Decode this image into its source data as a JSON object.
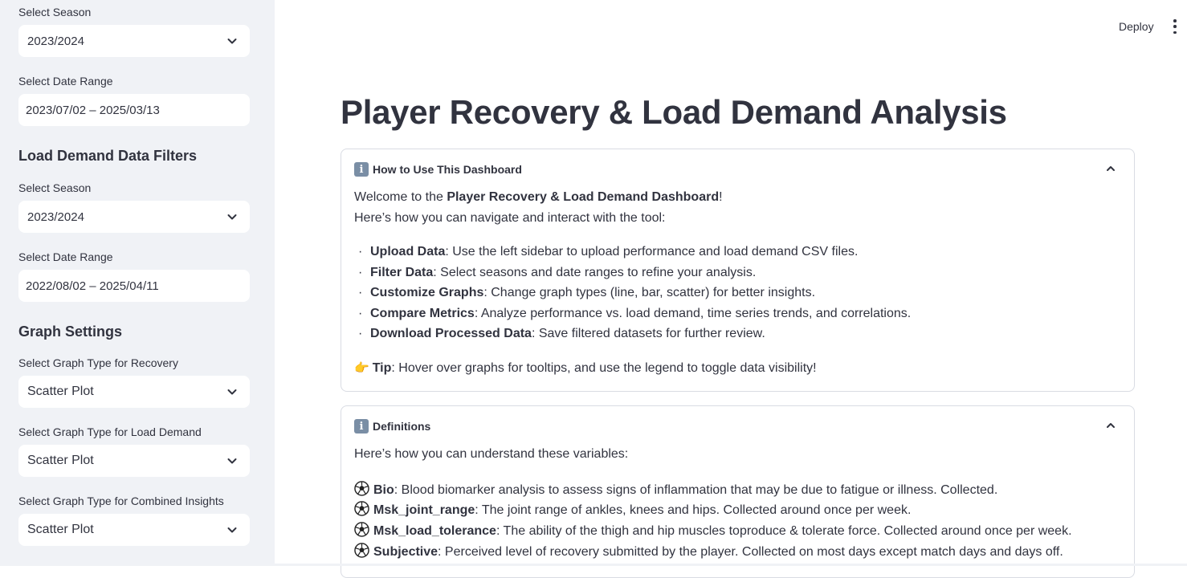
{
  "sidebar": {
    "recovery_season_label": "Select Season",
    "recovery_season_value": "2023/2024",
    "recovery_date_label": "Select Date Range",
    "recovery_date_value": "2023/07/02 – 2025/03/13",
    "load_heading": "Load Demand Data Filters",
    "load_season_label": "Select Season",
    "load_season_value": "2023/2024",
    "load_date_label": "Select Date Range",
    "load_date_value": "2022/08/02 – 2025/04/11",
    "graph_heading": "Graph Settings",
    "graph_recovery_label": "Select Graph Type for Recovery",
    "graph_recovery_value": "Scatter Plot",
    "graph_load_label": "Select Graph Type for Load Demand",
    "graph_load_value": "Scatter Plot",
    "graph_combined_label": "Select Graph Type for Combined Insights",
    "graph_combined_value": "Scatter Plot"
  },
  "header": {
    "deploy_label": "Deploy"
  },
  "main": {
    "title": "Player Recovery & Load Demand Analysis",
    "how_to": {
      "title": "How to Use This Dashboard",
      "welcome_prefix": "Welcome to the ",
      "welcome_bold": "Player Recovery & Load Demand Dashboard",
      "welcome_suffix": "!",
      "intro": "Here’s how you can navigate and interact with the tool:",
      "items": [
        {
          "bold": "Upload Data",
          "text": ": Use the left sidebar to upload performance and load demand CSV files."
        },
        {
          "bold": "Filter Data",
          "text": ": Select seasons and date ranges to refine your analysis."
        },
        {
          "bold": "Customize Graphs",
          "text": ": Change graph types (line, bar, scatter) for better insights."
        },
        {
          "bold": "Compare Metrics",
          "text": ": Analyze performance vs. load demand, time series trends, and correlations."
        },
        {
          "bold": "Download Processed Data",
          "text": ": Save filtered datasets for further review."
        }
      ],
      "tip_bold": "Tip",
      "tip_text": ": Hover over graphs for tooltips, and use the legend to toggle data visibility!"
    },
    "definitions": {
      "title": "Definitions",
      "intro": "Here’s how you can understand these variables:",
      "items": [
        {
          "bold": "Bio",
          "text": ": Blood biomarker analysis to assess signs of inflammation that may be due to fatigue or illness. Collected."
        },
        {
          "bold": "Msk_joint_range",
          "text": ": The joint range of ankles, knees and hips. Collected around once per week."
        },
        {
          "bold": "Msk_load_tolerance",
          "text": ": The ability of the thigh and hip muscles toproduce & tolerate force. Collected around once per week."
        },
        {
          "bold": "Subjective",
          "text": ": Perceived level of recovery submitted by the player. Collected on most days except match days and days off."
        }
      ]
    }
  },
  "icons": {
    "info": "info-icon",
    "bullet": "bullet-dot",
    "tip": "pointing-hand-icon",
    "soccer": "soccer-ball-icon",
    "select_arrow": "chevron-down-icon",
    "collapse": "chevron-up-icon",
    "menu": "kebab-menu-icon"
  },
  "colors": {
    "sidebar_bg": "#f0f2f6",
    "text": "#31333f",
    "border": "#d9dce3"
  }
}
